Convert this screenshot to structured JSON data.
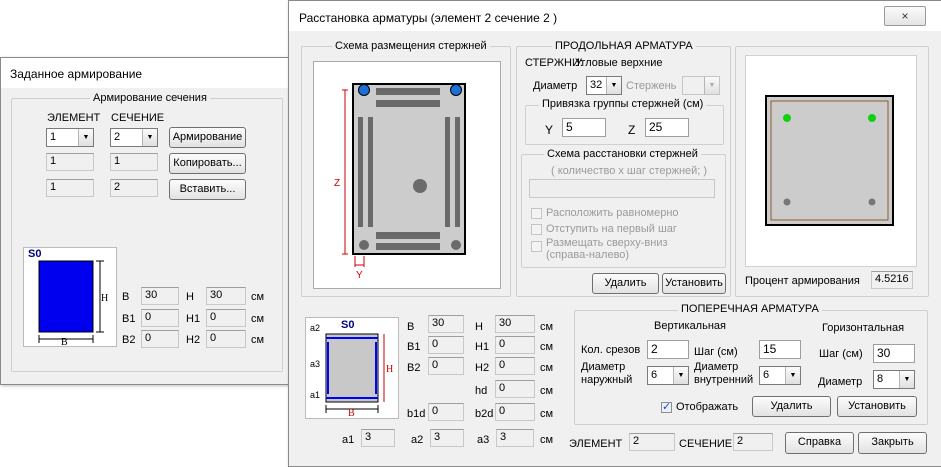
{
  "win1": {
    "title": "Заданное армирование",
    "group_title": "Армирование сечения",
    "element_label": "ЭЛЕМЕНТ",
    "section_label": "СЕЧЕНИЕ",
    "element_value": "1",
    "section_value": "2",
    "rows": [
      [
        "1",
        "1"
      ],
      [
        "1",
        "2"
      ]
    ],
    "buttons": {
      "reinforcement": "Армирование",
      "copy": "Копировать...",
      "paste": "Вставить..."
    },
    "shape_label": "S0",
    "dims": {
      "B": "30",
      "H": "30",
      "B1": "0",
      "H1": "0",
      "B2": "0",
      "H2": "0",
      "unit": "см"
    }
  },
  "win2": {
    "title": "Расстановка арматуры  (элемент 2  сечение 2 )",
    "close": "×",
    "scheme_title": "Схема размещения стержней",
    "long": {
      "title": "ПРОДОЛЬНАЯ АРМАТУРА",
      "rods_label": "СТЕРЖНИ:",
      "rods_value": "Угловые верхние",
      "diameter_label": "Диаметр",
      "diameter_value": "32",
      "rod_label": "Стержень",
      "binding_title": "Привязка группы стержней (см)",
      "y_label": "Y",
      "y_value": "5",
      "z_label": "Z",
      "z_value": "25",
      "layout_title": "Схема расстановки стержней",
      "layout_hint": "( количество х шаг стержней; )",
      "options": [
        "Расположить равномерно",
        "Отступить на первый шаг",
        "Размещать сверху-вниз",
        "(справа-налево)"
      ],
      "delete": "Удалить",
      "install": "Установить"
    },
    "percent_label": "Процент армирования",
    "percent_value": "4.5216",
    "scheme_axes": {
      "z": "Z",
      "y": "Y"
    },
    "section_shape": {
      "label": "S0",
      "a_labels": [
        "a2",
        "a3",
        "a1"
      ],
      "B": "B",
      "H": "H"
    },
    "dims": {
      "B": "30",
      "H": "30",
      "B1": "0",
      "H1": "0",
      "B2": "0",
      "H2": "0",
      "hd": "0",
      "b1d": "0",
      "b2d": "0",
      "a1": "3",
      "a2": "3",
      "a3": "3",
      "unit": "см"
    },
    "trans": {
      "title": "ПОПЕРЕЧНАЯ АРМАТУРА",
      "vertical": "Вертикальная",
      "horizontal": "Горизонтальная",
      "cuts_label": "Кол. срезов",
      "cuts_value": "2",
      "step_label": "Шаг (см)",
      "step_v_value": "15",
      "step_h_value": "30",
      "d_outer_label1": "Диаметр",
      "d_outer_label2": "наружный",
      "d_outer_value": "6",
      "d_inner_label1": "Диаметр",
      "d_inner_label2": "внутренний",
      "d_inner_value": "6",
      "diameter_label": "Диаметр",
      "diameter_h_value": "8",
      "display_label": "Отображать",
      "delete": "Удалить",
      "install": "Установить"
    },
    "footer": {
      "element_label": "ЭЛЕМЕНТ",
      "element_value": "2",
      "section_label": "СЕЧЕНИЕ",
      "section_value": "2",
      "help": "Справка",
      "close": "Закрыть"
    },
    "colors": {
      "rebar_blue": "#1e6fd8",
      "rebar_green": "#10d010",
      "section_fill": "#cccccc",
      "highlight": "#0000ff"
    }
  }
}
